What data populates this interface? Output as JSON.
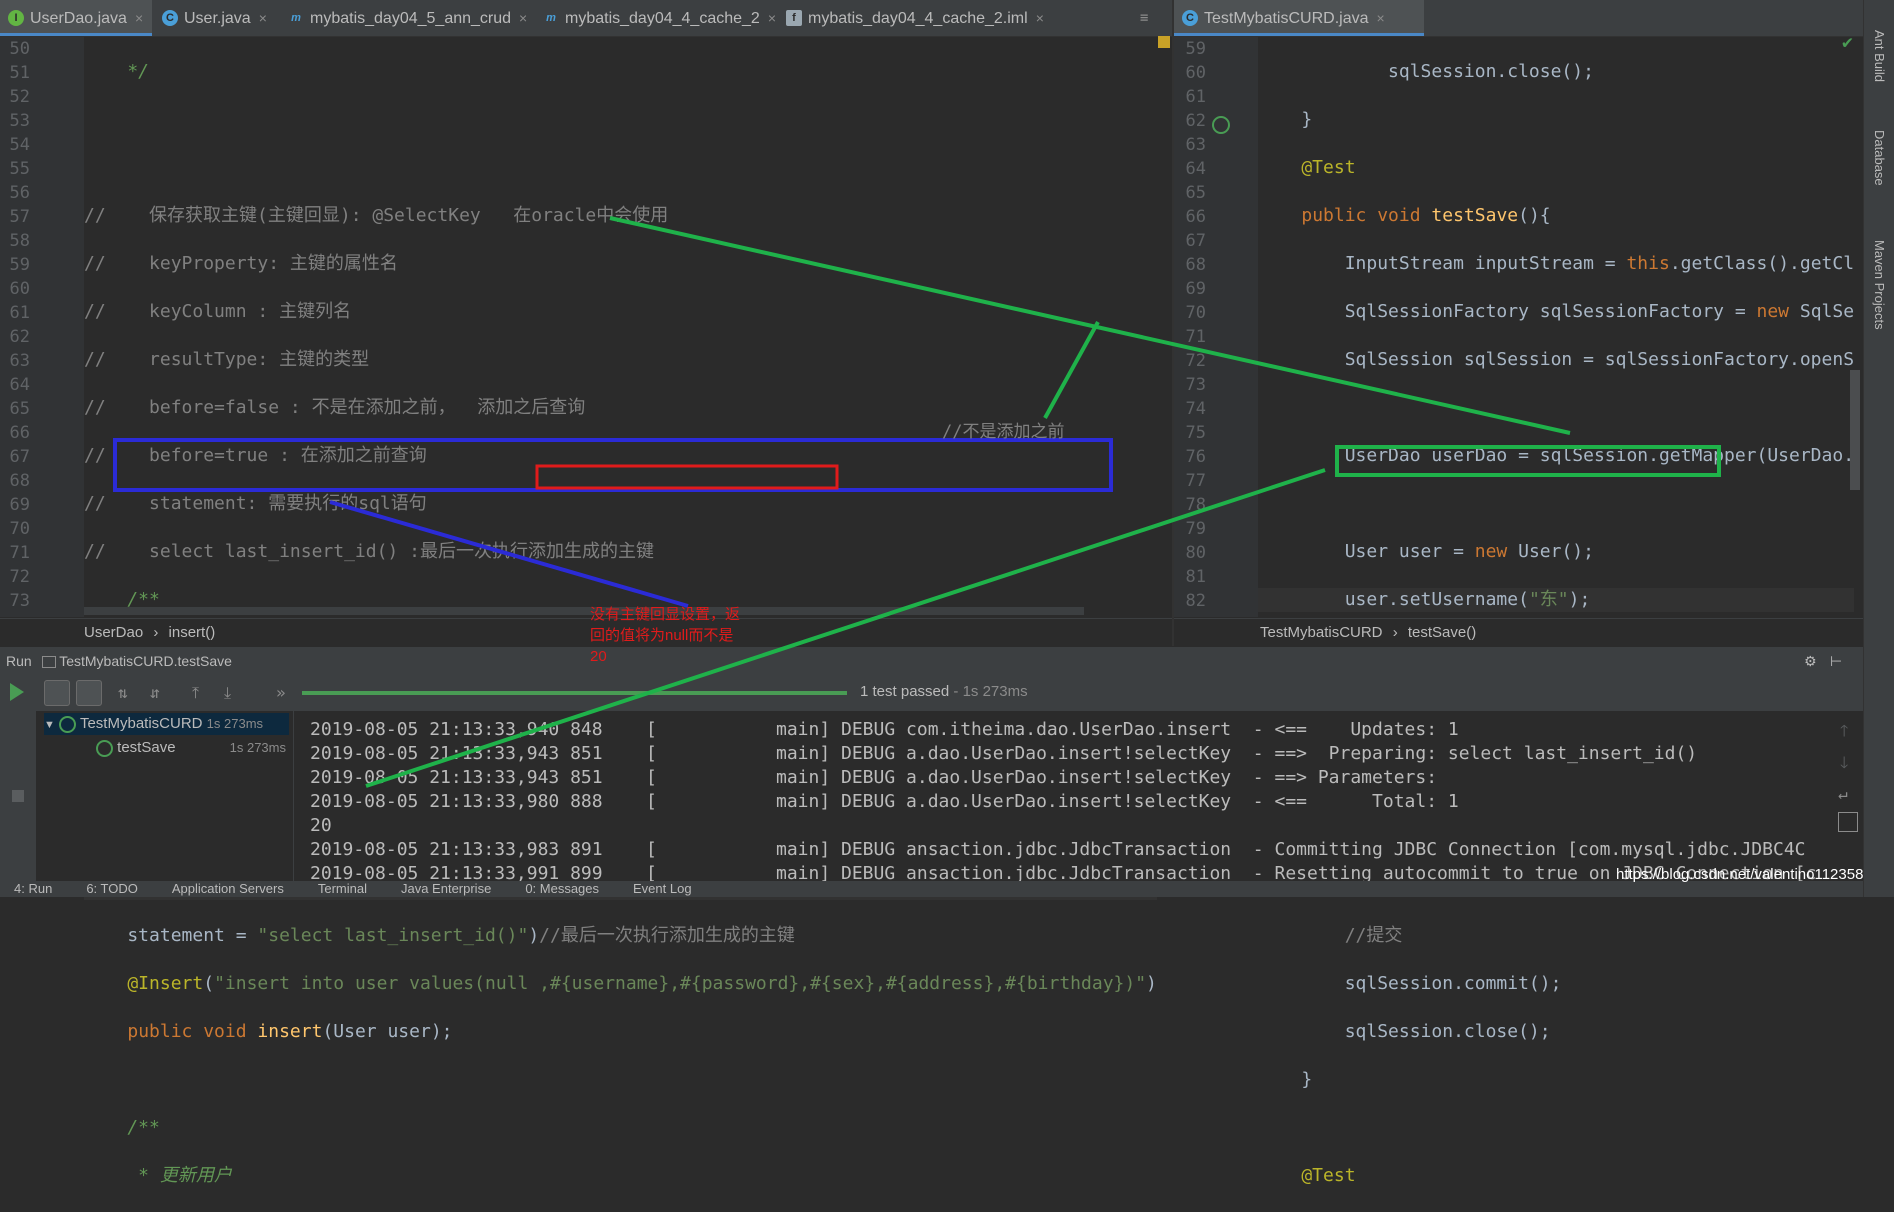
{
  "tabs_left": [
    {
      "label": "UserDao.java",
      "icon": "I",
      "active": true
    },
    {
      "label": "User.java",
      "icon": "C",
      "active": false
    },
    {
      "label": "mybatis_day04_5_ann_crud",
      "icon": "m",
      "active": false
    },
    {
      "label": "mybatis_day04_4_cache_2",
      "icon": "m",
      "active": false
    },
    {
      "label": "mybatis_day04_4_cache_2.iml",
      "icon": "f",
      "active": false
    }
  ],
  "tabs_right": [
    {
      "label": "TestMybatisCURD.java",
      "icon": "C",
      "active": true
    }
  ],
  "close_glyph": "×",
  "left_editor": {
    "line_numbers": [
      "50",
      "51",
      "52",
      "53",
      "54",
      "55",
      "56",
      "57",
      "58",
      "59",
      "60",
      "61",
      "62",
      "63",
      "64",
      "65",
      "66",
      "67",
      "68",
      "69",
      "70",
      "71",
      "72",
      "73"
    ],
    "breadcrumb": [
      "UserDao",
      "insert()"
    ]
  },
  "right_editor": {
    "line_numbers": [
      "59",
      "60",
      "61",
      "62",
      "63",
      "64",
      "65",
      "66",
      "67",
      "68",
      "69",
      "70",
      "71",
      "72",
      "73",
      "74",
      "75",
      "76",
      "77",
      "78",
      "79",
      "80",
      "81",
      "82"
    ],
    "breadcrumb": [
      "TestMybatisCURD",
      "testSave()"
    ]
  },
  "annotations": {
    "not_before_add": "//不是添加之前",
    "red_note": "没有主键回显设置，返回的值将为null而不是20"
  },
  "run_panel": {
    "header": "Run",
    "config": "TestMybatisCURD.testSave",
    "status": "1 test passed",
    "duration": "- 1s 273ms",
    "tree": [
      {
        "label": "TestMybatisCURD",
        "time": "1s 273ms"
      },
      {
        "label": "testSave",
        "time": "1s 273ms"
      }
    ],
    "log": [
      "2019-08-05 21:13:33,940 848    [           main] DEBUG com.itheima.dao.UserDao.insert  - <==    Updates: 1",
      "2019-08-05 21:13:33,943 851    [           main] DEBUG a.dao.UserDao.insert!selectKey  - ==>  Preparing: select last_insert_id()",
      "2019-08-05 21:13:33,943 851    [           main] DEBUG a.dao.UserDao.insert!selectKey  - ==> Parameters: ",
      "2019-08-05 21:13:33,980 888    [           main] DEBUG a.dao.UserDao.insert!selectKey  - <==      Total: 1",
      "20",
      "2019-08-05 21:13:33,983 891    [           main] DEBUG ansaction.jdbc.JdbcTransaction  - Committing JDBC Connection [com.mysql.jdbc.JDBC4C",
      "2019-08-05 21:13:33,991 899    [           main] DEBUG ansaction.jdbc.JdbcTransaction  - Resetting autocommit to true on JDBC Connection [c"
    ]
  },
  "bottom_tabs": [
    "4: Run",
    "6: TODO",
    "Application Servers",
    "Terminal",
    "Java Enterprise",
    "0: Messages",
    "Event Log"
  ],
  "right_sidebar": [
    "Ant Build",
    "Database",
    "Maven Projects"
  ],
  "watermark": "https://blog.csdn.net/valentino112358"
}
